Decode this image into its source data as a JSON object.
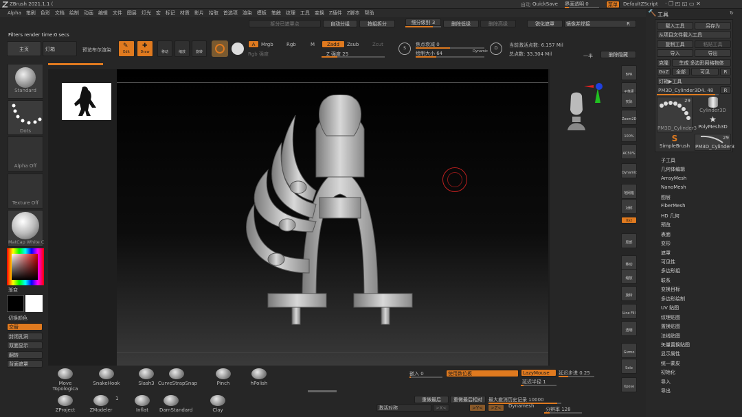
{
  "window": {
    "title": "ZBrush 2021.1.1 (",
    "autosave": "自动",
    "quicksave": "QuickSave",
    "transparency": "界面透明 0",
    "menu_btn": "菜单",
    "script": "DefaultZScript"
  },
  "menu": [
    "Alpha",
    "笔刷",
    "色彩",
    "文档",
    "绘制",
    "动画",
    "编辑",
    "文件",
    "图层",
    "灯光",
    "宏",
    "标记",
    "材质",
    "影片",
    "拾取",
    "首选项",
    "渲染",
    "模板",
    "笔触",
    "纹理",
    "工具",
    "变换",
    "Z插件",
    "Z脚本",
    "帮助"
  ],
  "status": "Filters render time:0 secs",
  "top_left": {
    "home": "主页",
    "lightbox": "灯箱",
    "preview_render": "预览布尔渲染"
  },
  "top_greys": {
    "split_hidden": "拆分已遮罩点",
    "auto_group": "自动分组",
    "split_by_group": "按组拆分",
    "subdiv_level": "细分级别 3",
    "delete_lower": "删除低级",
    "delete_higher": "删除高级",
    "smooth_mask": "锐化遮罩",
    "mirror_weld": "镜像并焊接",
    "r": "R"
  },
  "draw_tools": {
    "edit": "Edit",
    "draw": "Draw",
    "move": "移动",
    "scale": "缩放",
    "rotate": "旋转"
  },
  "material_mode": {
    "a": "A",
    "mrgb": "Mrgb",
    "rgb": "Rgb",
    "m": "M",
    "rgb_intensity": "Rgb 强度",
    "zadd": "Zadd",
    "zsub": "Zsub",
    "zcut": "Zcut",
    "z_intensity": "Z 强度 25"
  },
  "focal": {
    "focal_shift": "焦点衰减 0",
    "draw_size": "绘制大小 64",
    "dynamic": "Dynamic",
    "s": "S",
    "d": "D"
  },
  "points": {
    "active": "当前激活点数: 6.157 Mil",
    "total": "总点数: 33.304 Mil",
    "half": "一半",
    "del_hidden": "删除隐藏"
  },
  "left_shelf": {
    "standard": "Standard",
    "dots": "Dots",
    "alpha_off": "Alpha Off",
    "texture_off": "Texture Off",
    "matcap": "MatCap White C",
    "gradient": "渐变",
    "switch_color": "切换颜色",
    "alternate": "交替",
    "close_holes": "封闭孔洞",
    "double_display": "双面显示",
    "flip": "翻转",
    "back_mask": "背面遮罩"
  },
  "right_toolbar": [
    "BPR",
    "子像素",
    "实际",
    "Zoom2D",
    "100%",
    "AC50%",
    "Dynamic\n透视",
    "地网格",
    "对称",
    "Xyz",
    "局部",
    "移动",
    "缩放",
    "旋转",
    "Line Fill",
    "透明",
    "Gizmo",
    "Solo",
    "Xpose"
  ],
  "tool_panel": {
    "header": "工具",
    "load_tool": "载入工具",
    "save_as": "另存为",
    "import_from_file": "从项目文件载入工具",
    "copy_tool": "复制工具",
    "paste_tool": "粘贴工具",
    "import": "导入",
    "export": "导出",
    "clone": "克隆",
    "make_polymesh": "生成 多边形网格物体",
    "goz": "GoZ",
    "all": "全部",
    "visible": "可见",
    "r": "R",
    "lightbox_tool": "灯箱▶工具",
    "current_tool": "PM3D_Cylinder3D4. 48",
    "r2": "R",
    "thumbs": [
      {
        "name": "PM3D_Cylinder3",
        "count": "29"
      },
      {
        "name": "Cylinder3D",
        "count": ""
      },
      {
        "name": "PolyMesh3D",
        "count": ""
      },
      {
        "name": "SimpleBrush",
        "count": ""
      },
      {
        "name": "PM3D_Cylinder3",
        "count": "29"
      }
    ],
    "sections": [
      "子工具",
      "几何体编辑",
      "ArrayMesh",
      "NanoMesh",
      "图层",
      "FiberMesh",
      "HD 几何",
      "预览",
      "表面",
      "变形",
      "遮罩",
      "可见性",
      "多边形组",
      "联系",
      "变换目标",
      "多边形绘制",
      "UV 贴图",
      "纹理贴图",
      "置换贴图",
      "法线贴图",
      "矢量置换贴图",
      "显示属性",
      "统一蒙皮",
      "初始化",
      "导入",
      "导出"
    ]
  },
  "brushes_row1": [
    "Move Topologica",
    "SnakeHook",
    "Slash3",
    "CurveStrapSnap",
    "Pinch",
    "hPolish"
  ],
  "brushes_row2": [
    "ZProject",
    "ZModeler",
    "Inflat",
    "DamStandard",
    "Clay"
  ],
  "zmodeler_badge": "1",
  "bottom": {
    "lazy_step": "延迟步进 0.25",
    "lazy_radius": "延迟半径 1",
    "lazy_mouse": "LazyMouse",
    "use_pad": "使用数位板",
    "draw_in": "嵌入 0",
    "replay_last": "重做最后",
    "replay_relative": "重做最后相对",
    "max_undo": "最大撤消历史记录 10000",
    "dynamesh": "Dynamesh",
    "resolution": "分辨率 128",
    "activate_sym": "激活对称",
    "x": ">X<",
    "y": ">Y<",
    "z": ">Z<"
  }
}
